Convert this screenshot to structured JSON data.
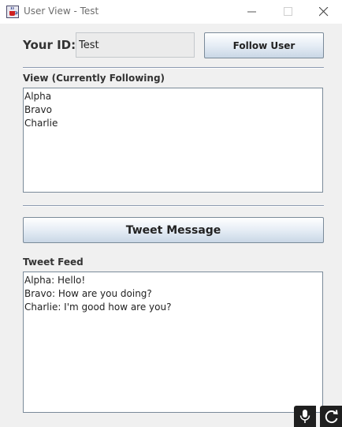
{
  "window": {
    "title": "User View - Test",
    "icons": {
      "app": "java-cup-icon",
      "minimize": "minimize-icon",
      "maximize": "maximize-icon",
      "close": "close-icon"
    }
  },
  "user": {
    "id_label": "Your ID:",
    "id_value": "Test",
    "follow_button": "Follow User"
  },
  "following": {
    "label": "View (Currently Following)",
    "items": [
      "Alpha",
      "Bravo",
      "Charlie"
    ]
  },
  "tweet": {
    "button": "Tweet Message"
  },
  "feed": {
    "label": "Tweet Feed",
    "items": [
      "Alpha: Hello!",
      "Bravo: How are you doing?",
      "Charlie: I'm good how are you?"
    ]
  },
  "tray": {
    "icons": [
      "microphone-icon",
      "refresh-icon"
    ]
  },
  "colors": {
    "background": "#f0f0f0",
    "button_gradient_top": "#ffffff",
    "button_gradient_bottom": "#c9d7e6",
    "border": "#7a8a99"
  }
}
